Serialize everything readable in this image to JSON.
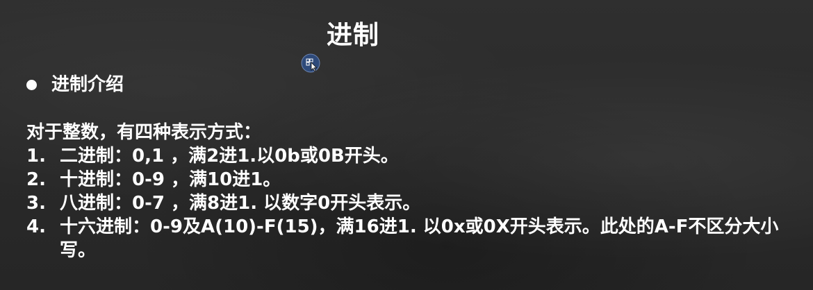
{
  "slide": {
    "title": "进制",
    "bullet": "进制介绍",
    "intro": "对于整数，有四种表示方式：",
    "items": [
      {
        "num": "1.",
        "text": "二进制：0,1 ，满2进1.以0b或0B开头。"
      },
      {
        "num": "2.",
        "text": "十进制：0-9 ，满10进1。"
      },
      {
        "num": "3.",
        "text": "八进制：0-7 ，满8进1. 以数字0开头表示。"
      },
      {
        "num": "4.",
        "text": "十六进制：0-9及A(10)-F(15)，满16进1. 以0x或0X开头表示。此处的A-F不区分大小写。"
      }
    ]
  },
  "icons": {
    "pointer": "cursor-pointer-icon",
    "bullet": "filled-circle-bullet-icon"
  },
  "colors": {
    "background": "#2b2b2b",
    "text": "#ffffff",
    "marker": "#2e4a7a"
  }
}
